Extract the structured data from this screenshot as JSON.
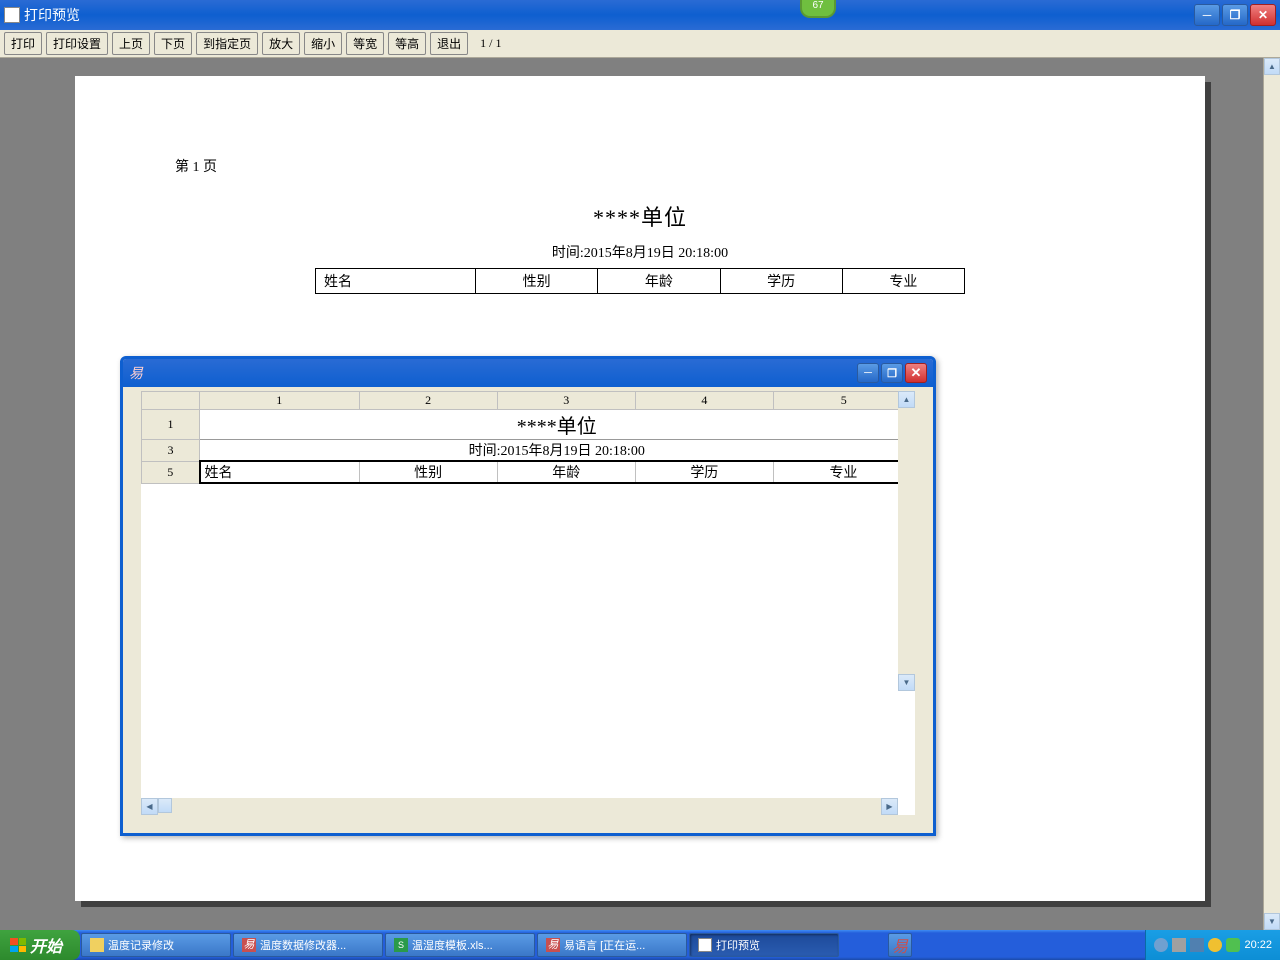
{
  "titlebar": {
    "title": "打印预览",
    "badge": "67"
  },
  "toolbar": {
    "print": "打印",
    "setup": "打印设置",
    "prev": "上页",
    "next": "下页",
    "goto": "到指定页",
    "zoomin": "放大",
    "zoomout": "缩小",
    "fitwidth": "等宽",
    "fitheight": "等高",
    "exit": "退出",
    "pageinfo": "1 / 1"
  },
  "page": {
    "pagenum": "第 1 页",
    "heading": "****单位",
    "timestamp": "时间:2015年8月19日 20:18:00",
    "headers": [
      "姓名",
      "性别",
      "年龄",
      "学历",
      "专业"
    ]
  },
  "dialog": {
    "icon": "易",
    "cols": [
      "1",
      "2",
      "3",
      "4",
      "5"
    ],
    "rows": [
      "1",
      "3",
      "5"
    ],
    "title_cell": "****单位",
    "time_cell": "时间:2015年8月19日 20:18:00",
    "headers": [
      "姓名",
      "性别",
      "年龄",
      "学历",
      "专业"
    ]
  },
  "taskbar": {
    "start": "开始",
    "items": [
      {
        "label": "温度记录修改",
        "color": "#f0d060"
      },
      {
        "label": "温度数据修改器...",
        "color": "#c85050"
      },
      {
        "label": "温湿度模板.xls...",
        "color": "#2a9a4a"
      },
      {
        "label": "易语言 [正在运...",
        "color": "#c85050"
      },
      {
        "label": "打印预览",
        "color": "#ffffff"
      }
    ],
    "clock": "20:22"
  }
}
